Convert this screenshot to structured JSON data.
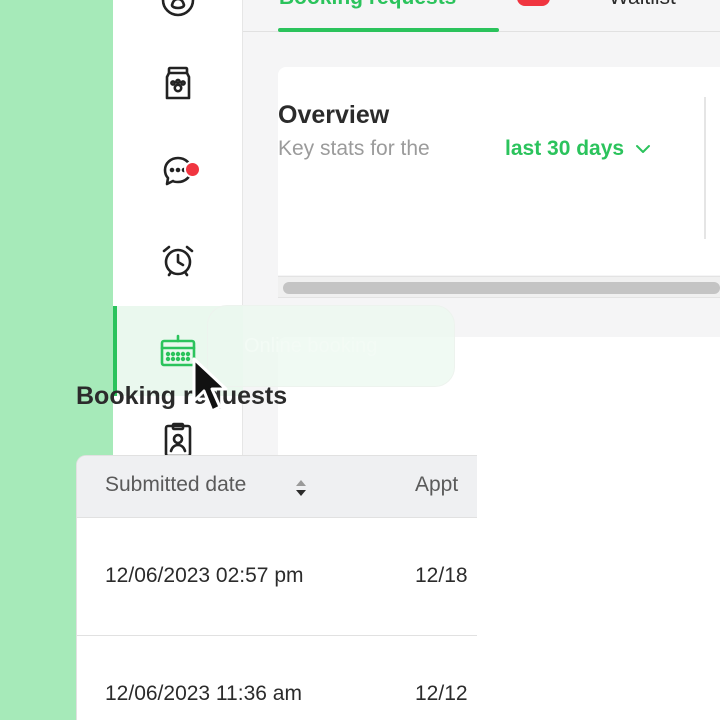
{
  "colors": {
    "accent": "#2bc35c",
    "badge": "#f03540",
    "strip": "#a6eab9"
  },
  "sidebar": {
    "items": [
      {
        "icon": "paw-icon"
      },
      {
        "icon": "pet-food-bag-icon"
      },
      {
        "icon": "chat-icon",
        "has_notification": true
      },
      {
        "icon": "alarm-clock-icon"
      },
      {
        "icon": "calendar-icon",
        "active": true
      },
      {
        "icon": "id-badge-icon"
      },
      {
        "icon": "notes-icon"
      },
      {
        "icon": "dollar-icon"
      },
      {
        "icon": "megaphone-icon"
      }
    ]
  },
  "tooltip": {
    "text": "Online booking"
  },
  "tabs": {
    "items": [
      {
        "label": "Booking requests",
        "active": true
      },
      {
        "label": "Waitlist"
      }
    ]
  },
  "overview": {
    "title": "Overview",
    "subtitle": "Key stats for the",
    "range_label": "last 30 days"
  },
  "bookings": {
    "title": "Booking requests",
    "columns": [
      "Submitted date",
      "Appt"
    ],
    "rows": [
      [
        "12/06/2023 02:57 pm",
        "12/18"
      ],
      [
        "12/06/2023 11:36 am",
        "12/12"
      ]
    ]
  }
}
